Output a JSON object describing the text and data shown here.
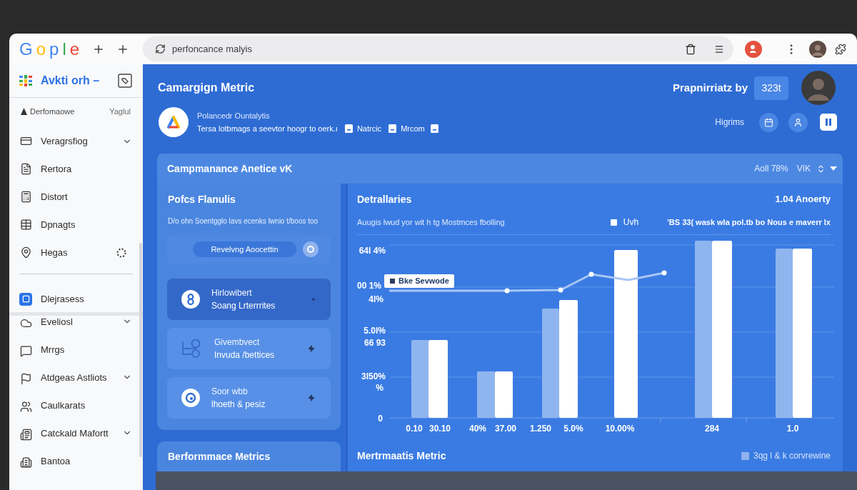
{
  "browser": {
    "logo": "Gople",
    "address": "perfoncance malyis"
  },
  "sidebar": {
    "title": "Avkti orh –",
    "subheader": {
      "label": "Derfomaowe",
      "value": "Yaglul"
    },
    "sections": [
      {
        "items": [
          {
            "label": "Veragrsfiog",
            "selected": false,
            "expandable": true,
            "loading": false
          },
          {
            "label": "Rertora",
            "selected": false,
            "expandable": false,
            "loading": false
          },
          {
            "label": "Distort",
            "selected": false,
            "expandable": false,
            "loading": false
          },
          {
            "label": "Dpnagts",
            "selected": false,
            "expandable": false,
            "loading": false
          },
          {
            "label": "Hegas",
            "selected": false,
            "expandable": false,
            "loading": true
          }
        ]
      },
      {
        "items": [
          {
            "label": "Dlejrasess",
            "selected": true,
            "expandable": false,
            "loading": false
          }
        ]
      },
      {
        "items": [
          {
            "label": "Eveliosl",
            "selected": false,
            "expandable": true,
            "loading": false
          },
          {
            "label": "Mrrgs",
            "selected": false,
            "expandable": false,
            "loading": false
          },
          {
            "label": "Atdgeas Astliots",
            "selected": false,
            "expandable": true,
            "loading": false
          },
          {
            "label": "Caulkarats",
            "selected": false,
            "expandable": false,
            "loading": false
          },
          {
            "label": "Catckald Mafortt",
            "selected": false,
            "expandable": true,
            "loading": false
          },
          {
            "label": "Bantoa",
            "selected": false,
            "expandable": false,
            "loading": false
          }
        ]
      }
    ]
  },
  "header": {
    "title": "Camargign Metric",
    "account_label": "Prapnirriatz by",
    "account_badge": "323t",
    "app_name": "Polancedr Ountalytis",
    "description": "Tersa lotbmags a seevtor hoogr to oerk.ı",
    "tags": [
      "Natrcic",
      "Mrcom"
    ],
    "actions_label": "Higrims"
  },
  "panel": {
    "title": "Campmanance Anetice vK",
    "stats": [
      "Aoll 78%",
      "VIK"
    ]
  },
  "summary_card": {
    "title": "Pofcs Flanulis",
    "subtitle": "D/o ohn Soentgglo lavs ecenks lwnio t/boos too",
    "pill": "Revelvng Aoocettin",
    "items": [
      {
        "title": "Hirlowibert",
        "subtitle": "Soang Lrterrrites",
        "selected": true
      },
      {
        "title": "Givembvect",
        "subtitle": "Invuda /bettices",
        "selected": false
      },
      {
        "title": "Soor wbb",
        "subtitle": "lhoeth & pesiz",
        "selected": false
      }
    ]
  },
  "metrics_card": {
    "title": "Berformmace Metrics"
  },
  "chart_card": {
    "title": "Detrallaries",
    "summary": "1.04 Anoerty",
    "subtitle": "Auugis lwud yor wit h tg Mostmces fbolling",
    "legend": "Uvh",
    "note": "'BS 33( wask wla pol.tb bo Nous e maverr lx",
    "tooltip": "Bke Sevwode",
    "y_labels": [
      "64l 4%",
      "00 1%",
      "4l%",
      "5.0l%",
      "66 93",
      "3l50%",
      "%",
      "0"
    ],
    "x_labels": [
      "0.10",
      "30.10",
      "40%",
      "37.00",
      "1.250",
      "5.0%",
      "10.00%",
      "284",
      "1.0"
    ],
    "footer_title": "Mertrmaatis Metric",
    "footer_legend": "3qg l & k corvrewine"
  }
}
